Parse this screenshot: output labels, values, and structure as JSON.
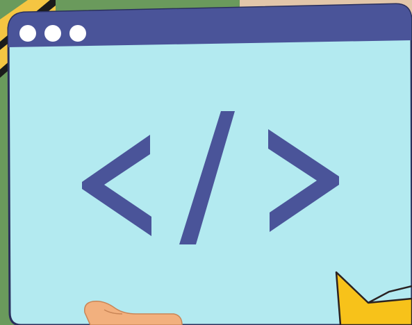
{
  "colors": {
    "background_left": "#6a9a5c",
    "background_right": "#e6cbb1",
    "window_body": "#b3eaf0",
    "window_titlebar": "#4a5499",
    "window_border": "#2a2f5c",
    "code_symbol": "#4a5499",
    "dot": "#ffffff",
    "stripe_yellow": "#f5c542",
    "stripe_black": "#1b1b1b",
    "hand": "#f2b07e",
    "star": "#f7c21a"
  },
  "window": {
    "controls": [
      {
        "name": "close-dot",
        "icon": "circle-icon"
      },
      {
        "name": "minimize-dot",
        "icon": "circle-icon"
      },
      {
        "name": "maximize-dot",
        "icon": "circle-icon"
      }
    ],
    "content_icon": "code-brackets-icon"
  },
  "decorations": [
    "caution-stripes",
    "hand",
    "star-icon"
  ]
}
